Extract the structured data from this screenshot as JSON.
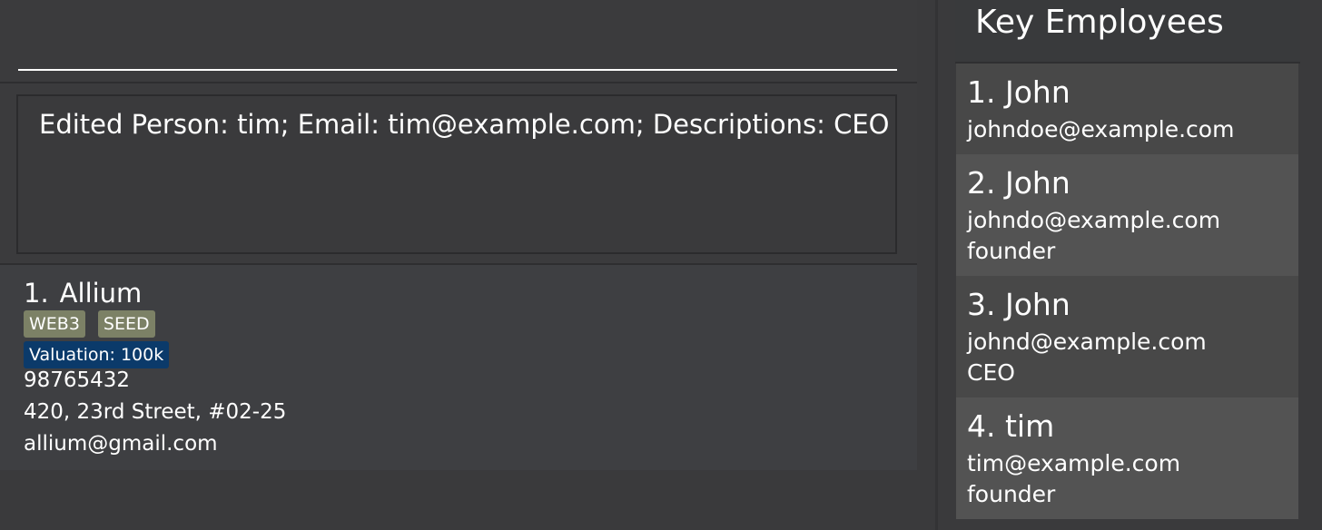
{
  "command_box": {
    "value": "",
    "placeholder": ""
  },
  "result_display": {
    "text": "Edited Person: tim; Email: tim@example.com; Descriptions: CEO"
  },
  "companies": [
    {
      "index": "1.",
      "name": "Allium",
      "tags": [
        "WEB3",
        "SEED"
      ],
      "valuation": "Valuation: 100k",
      "phone": "98765432",
      "address": "420, 23rd Street, #02-25",
      "email": "allium@gmail.com"
    }
  ],
  "key_employees": {
    "title": "Key Employees",
    "items": [
      {
        "name": "1. John",
        "email": "johndoe@example.com",
        "description": ""
      },
      {
        "name": "2. John",
        "email": "johndo@example.com",
        "description": "founder"
      },
      {
        "name": "3. John",
        "email": "johnd@example.com",
        "description": "CEO"
      },
      {
        "name": "4. tim",
        "email": "tim@example.com",
        "description": "founder"
      }
    ]
  },
  "colors": {
    "background": "#3a3a3c",
    "tag": "#7c8166",
    "valuation_badge": "#0b3a6a",
    "employee_card_odd": "#484848",
    "employee_card_even": "#535353",
    "text": "#ffffff"
  }
}
